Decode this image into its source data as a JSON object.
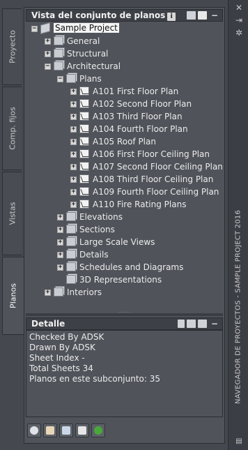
{
  "palette": {
    "side_title": "NAVEGADOR DE PROYECTOS - SAMPLE PROJECT 2016",
    "tabs": [
      "Proyecto",
      "Comp. fijos",
      "Vistas",
      "Planos"
    ],
    "active_tab": "Planos"
  },
  "sheet_set_view": {
    "title": "Vista del conjunto de planos",
    "info_badge": "i",
    "minimize": "−",
    "tree": [
      {
        "label": "Sample Project",
        "level": 0,
        "expander": "−",
        "icon": "project"
      },
      {
        "label": "General",
        "level": 1,
        "expander": "+",
        "icon": "set"
      },
      {
        "label": "Structural",
        "level": 1,
        "expander": "+",
        "icon": "set"
      },
      {
        "label": "Architectural",
        "level": 1,
        "expander": "−",
        "icon": "set"
      },
      {
        "label": "Plans",
        "level": 2,
        "expander": "−",
        "icon": "set"
      },
      {
        "label": "A101 First Floor Plan",
        "level": 3,
        "expander": "+",
        "icon": "sheet"
      },
      {
        "label": "A102 Second Floor Plan",
        "level": 3,
        "expander": "+",
        "icon": "sheet"
      },
      {
        "label": "A103 Third Floor Plan",
        "level": 3,
        "expander": "+",
        "icon": "sheet"
      },
      {
        "label": "A104 Fourth Floor Plan",
        "level": 3,
        "expander": "+",
        "icon": "sheet"
      },
      {
        "label": "A105 Roof Plan",
        "level": 3,
        "expander": "+",
        "icon": "sheet"
      },
      {
        "label": "A106 First Floor Ceiling Plan",
        "level": 3,
        "expander": "+",
        "icon": "sheet"
      },
      {
        "label": "A107 Second Floor Ceiling Plan",
        "level": 3,
        "expander": "+",
        "icon": "sheet"
      },
      {
        "label": "A108 Third Floor Ceiling Plan",
        "level": 3,
        "expander": "+",
        "icon": "sheet"
      },
      {
        "label": "A109 Fourth Floor Ceiling Plan",
        "level": 3,
        "expander": "+",
        "icon": "sheet"
      },
      {
        "label": "A110 Fire Rating Plans",
        "level": 3,
        "expander": "+",
        "icon": "sheet"
      },
      {
        "label": "Elevations",
        "level": 2,
        "expander": "+",
        "icon": "set"
      },
      {
        "label": "Sections",
        "level": 2,
        "expander": "+",
        "icon": "set"
      },
      {
        "label": "Large Scale Views",
        "level": 2,
        "expander": "+",
        "icon": "set"
      },
      {
        "label": "Details",
        "level": 2,
        "expander": "+",
        "icon": "set"
      },
      {
        "label": "Schedules and Diagrams",
        "level": 2,
        "expander": "+",
        "icon": "set"
      },
      {
        "label": "3D Representations",
        "level": 2,
        "expander": "",
        "icon": "set"
      },
      {
        "label": "Interiors",
        "level": 1,
        "expander": "+",
        "icon": "set"
      }
    ]
  },
  "detail": {
    "title": "Detalle",
    "minimize": "−",
    "lines": [
      "Checked By ADSK",
      "Drawn By ADSK",
      "Sheet Index -",
      "Total Sheets 34",
      "Planos en este subconjunto: 35"
    ]
  },
  "toolbar": {
    "buttons": [
      "publish-icon",
      "transmittal-icon",
      "sheet-list-icon",
      "view-list-icon",
      "refresh-icon"
    ]
  }
}
